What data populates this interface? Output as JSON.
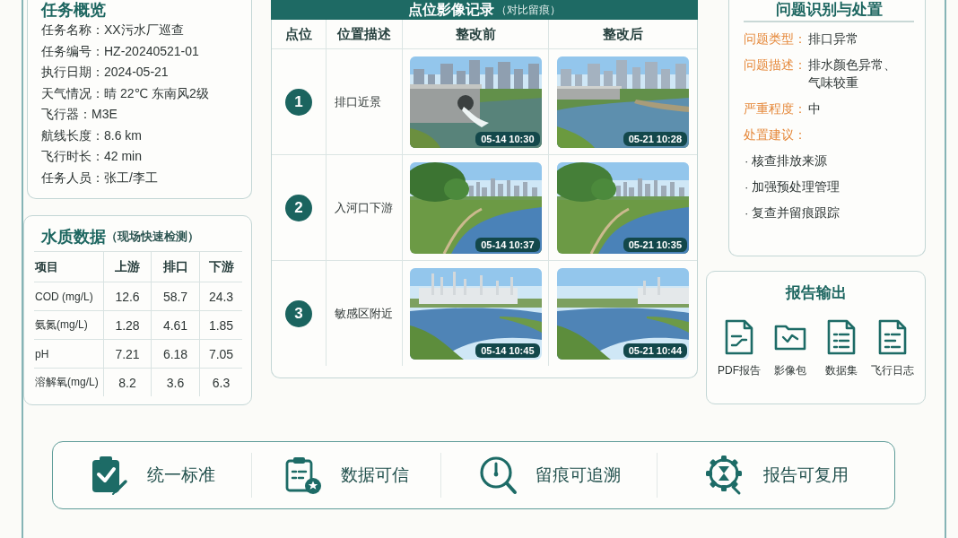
{
  "overview": {
    "title": "任务概览",
    "fields": [
      {
        "label": "任务名称：",
        "value": "XX污水厂巡查"
      },
      {
        "label": "任务编号：",
        "value": "HZ-20240521-01"
      },
      {
        "label": "执行日期：",
        "value": "2024-05-21"
      },
      {
        "label": "天气情况：",
        "value": "晴 22℃ 东南风2级"
      },
      {
        "label": "飞行器：",
        "value": "M3E"
      },
      {
        "label": "航线长度：",
        "value": "8.6 km"
      },
      {
        "label": "飞行时长：",
        "value": "42 min"
      },
      {
        "label": "任务人员：",
        "value": "张工/李工"
      }
    ]
  },
  "water_quality": {
    "title": "水质数据",
    "subtitle": "（现场快速检测）",
    "columns": [
      "项目",
      "上游",
      "排口",
      "下游"
    ],
    "rows": [
      [
        "COD (mg/L)",
        "12.6",
        "58.7",
        "24.3"
      ],
      [
        "氨氮(mg/L)",
        "1.28",
        "4.61",
        "1.85"
      ],
      [
        "pH",
        "7.21",
        "6.18",
        "7.05"
      ],
      [
        "溶解氧(mg/L)",
        "8.2",
        "3.6",
        "6.3"
      ]
    ]
  },
  "photo_records": {
    "title": "点位影像记录",
    "subtitle": "（对比留痕）",
    "columns": [
      "点位",
      "位置描述",
      "整改前",
      "整改后"
    ],
    "rows": [
      {
        "number": "1",
        "location": "排口近景",
        "before_time": "05-14 10:30",
        "after_time": "05-21 10:28"
      },
      {
        "number": "2",
        "location": "入河口下游",
        "before_time": "05-14 10:37",
        "after_time": "05-21 10:35"
      },
      {
        "number": "3",
        "location": "敏感区附近",
        "before_time": "05-14 10:45",
        "after_time": "05-21 10:44"
      }
    ]
  },
  "issue": {
    "title": "问题识别与处置",
    "fields": [
      {
        "label": "问题类型：",
        "value": "排口异常"
      },
      {
        "label": "问题描述：",
        "value": "排水颜色异常、气味较重"
      },
      {
        "label": "严重程度：",
        "value": "中"
      }
    ],
    "suggestion_label": "处置建议：",
    "suggestions": [
      "· 核查排放来源",
      "· 加强预处理管理",
      "· 复查并留痕跟踪"
    ]
  },
  "report_output": {
    "title": "报告输出",
    "items": [
      "PDF报告",
      "影像包",
      "数据集",
      "飞行日志"
    ]
  },
  "features": [
    "统一标准",
    "数据可信",
    "留痕可追溯",
    "报告可复用"
  ]
}
